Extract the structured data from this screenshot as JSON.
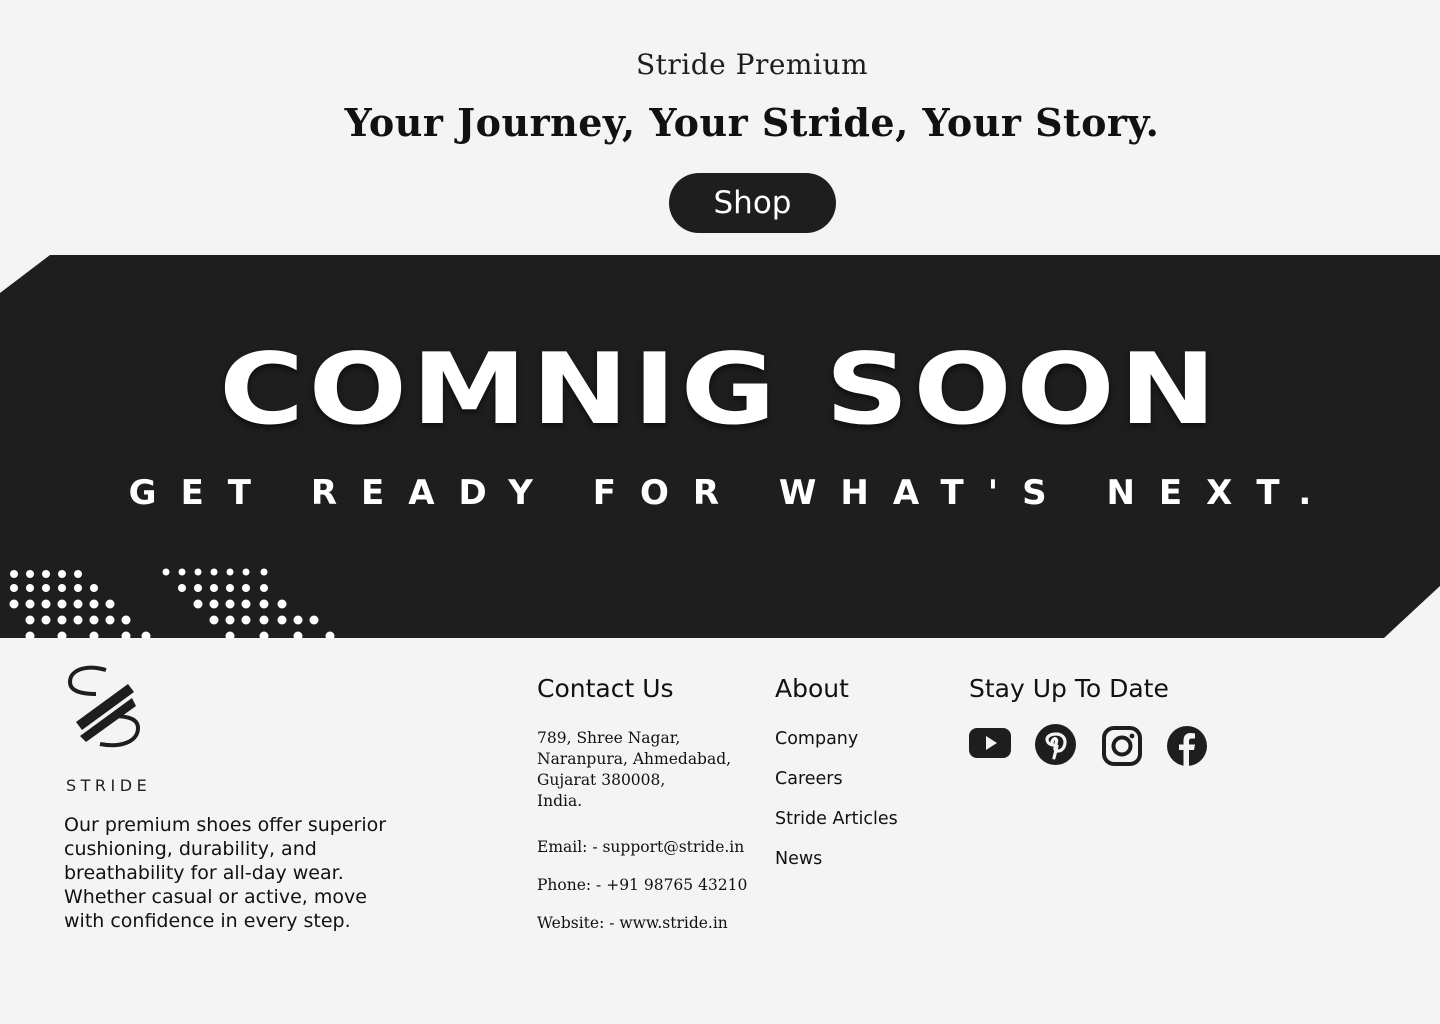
{
  "hero": {
    "subtitle": "Stride Premium",
    "title": "Your Journey, Your Stride, Your Story.",
    "shop_label": "Shop"
  },
  "banner": {
    "title": "COMNIG SOON",
    "subtitle": "GET READY FOR WHAT'S NEXT."
  },
  "footer": {
    "logo_text": "STRIDE",
    "description": "Our premium shoes offer superior cushioning, durability, and breathability for all-day wear. Whether casual or active, move with confidence in every step.",
    "contact": {
      "heading": "Contact Us",
      "address_lines": [
        "789, Shree Nagar,",
        "Naranpura, Ahmedabad,",
        "Gujarat 380008,",
        "India."
      ],
      "email": "Email: - support@stride.in",
      "phone": "Phone: - +91 98765 43210",
      "website": "Website: - www.stride.in"
    },
    "about": {
      "heading": "About",
      "links": [
        "Company",
        "Careers",
        "Stride Articles",
        "News"
      ]
    },
    "social": {
      "heading": "Stay Up To Date",
      "icons": [
        "youtube-icon",
        "pinterest-icon",
        "instagram-icon",
        "facebook-icon"
      ]
    }
  },
  "colors": {
    "dark": "#1e1e1e",
    "background": "#f4f4f4",
    "light": "#ffffff"
  }
}
